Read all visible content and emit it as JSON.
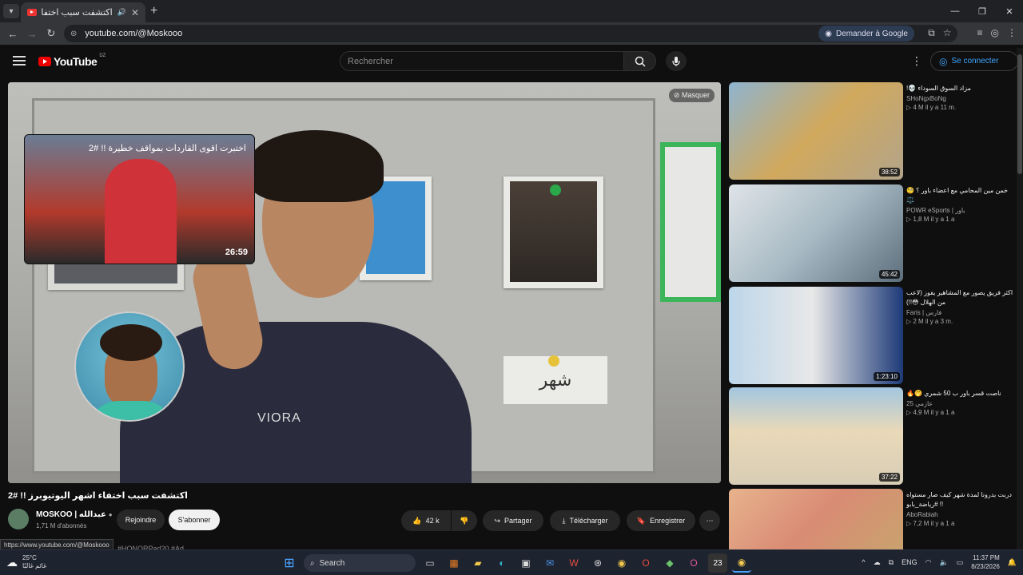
{
  "browser": {
    "tab_title": "اكتشفت سبب اختفاء اشهر ال",
    "url": "youtube.com/@Moskooo",
    "ask_google": "Demander à Google",
    "status_url": "https://www.youtube.com/@Moskooo"
  },
  "header": {
    "logo_text": "YouTube",
    "country_code": "DZ",
    "search_placeholder": "Rechercher",
    "signin_label": "Se connecter"
  },
  "player": {
    "hide_label": "Masquer",
    "endcard_title": "اختبرت اقوى القاردات بمواقف خطيرة !! #2",
    "endcard_duration": "26:59",
    "sign_text": "شهر",
    "hoodie_text": "VIORA"
  },
  "video": {
    "title": "اكتشفت سبب اختفاء اشهر اليوتيوبرز !! #2",
    "channel_name": "MOSKOO | عبدالله",
    "subscribers": "1,71 M d'abonnés",
    "join_label": "Rejoindre",
    "subscribe_label": "S'abonner",
    "likes": "42 k",
    "share_label": "Partager",
    "download_label": "Télécharger",
    "save_label": "Enregistrer",
    "hashtags": "#HONORPad20 #Ad"
  },
  "recommendations": [
    {
      "title": "مزاد السوق السوداء 💀!",
      "channel": "SHoNgxBoNg",
      "stats": "▷ 4 M   il y a 11 m.",
      "duration": "38:52"
    },
    {
      "title": "خمن مين المحامي مع اعضاء باور ؟ 🧐⚖️",
      "channel": "POWR eSports | باور",
      "stats": "▷ 1,8 M   il y a 1 a",
      "duration": "45:42"
    },
    {
      "title": "اكثر فريق يصور مع المشاهير يفوز (لاعب من الهلال 😳!!)",
      "channel": "Faris | فارس",
      "stats": "▷ 2 M   il y a 3 m.",
      "duration": "1:23:10"
    },
    {
      "title": "ناصت قسر باور ب 50 شمري 🤭🔥",
      "channel": "عازمي 25",
      "stats": "▷ 4,9 M   il y a 1 a",
      "duration": "37:22"
    },
    {
      "title": "دربت بدرونا لمدة شهر كيف صار مستواه !! #رياضة_بابو",
      "channel": "AboRabiah",
      "stats": "▷ 7,2 M   il y a 1 a",
      "duration": ""
    }
  ],
  "taskbar": {
    "temperature": "25°C",
    "weather_desc": "غائم غالبًا",
    "search_label": "Search",
    "lang": "ENG",
    "time": "11:37 PM",
    "date": "8/23/2026",
    "badge_count": "23"
  },
  "colors": {
    "yt_red": "#ff0000",
    "link_blue": "#3ea6ff",
    "bg": "#0f0f0f"
  }
}
